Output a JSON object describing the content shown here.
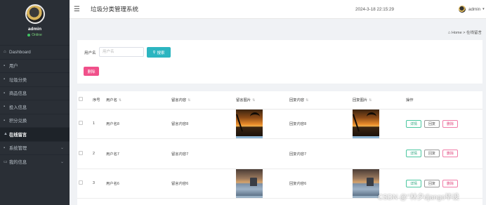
{
  "sidebar": {
    "profile": {
      "name": "admin",
      "status": "Online"
    },
    "items": [
      {
        "icon": "⌂",
        "label": "Dashboard"
      },
      {
        "icon": "▪",
        "label": "用户"
      },
      {
        "icon": "▪",
        "label": "垃圾分类"
      },
      {
        "icon": "▪",
        "label": "商品信息"
      },
      {
        "icon": "▪",
        "label": "投入信息"
      },
      {
        "icon": "▪",
        "label": "积分兑换"
      },
      {
        "icon": "▲",
        "label": "在线留言"
      },
      {
        "icon": "▪",
        "label": "系统管理"
      },
      {
        "icon": "▭",
        "label": "我的信息"
      }
    ]
  },
  "topbar": {
    "title": "垃圾分类管理系统",
    "datetime": "2024-3-18 22:15:29",
    "user": "admin"
  },
  "breadcrumb": {
    "home": "Home",
    "separator": ">",
    "current": "在线留言"
  },
  "search": {
    "label": "用户名",
    "placeholder": "用户名",
    "button_label": "搜索",
    "delete_label": "删除"
  },
  "table": {
    "headers": [
      "序号",
      "用户名",
      "留言内容",
      "留言图片",
      "回复内容",
      "回复图片",
      "操作"
    ],
    "rows": [
      {
        "index": "1",
        "username": "用户名8",
        "content": "留言内容8",
        "reply": "回复内容8",
        "msg_img": "sunset",
        "reply_img": "sunset"
      },
      {
        "index": "2",
        "username": "用户名7",
        "content": "留言内容7",
        "reply": "回复内容7",
        "msg_img": "",
        "reply_img": ""
      },
      {
        "index": "3",
        "username": "用户名6",
        "content": "留言内容6",
        "reply": "回复内容6",
        "msg_img": "lake",
        "reply_img": "lake"
      }
    ],
    "actions": {
      "detail": "详情",
      "reply": "回复",
      "delete": "删除"
    }
  },
  "watermark": "CSDN @‘’林夕django毕设"
}
